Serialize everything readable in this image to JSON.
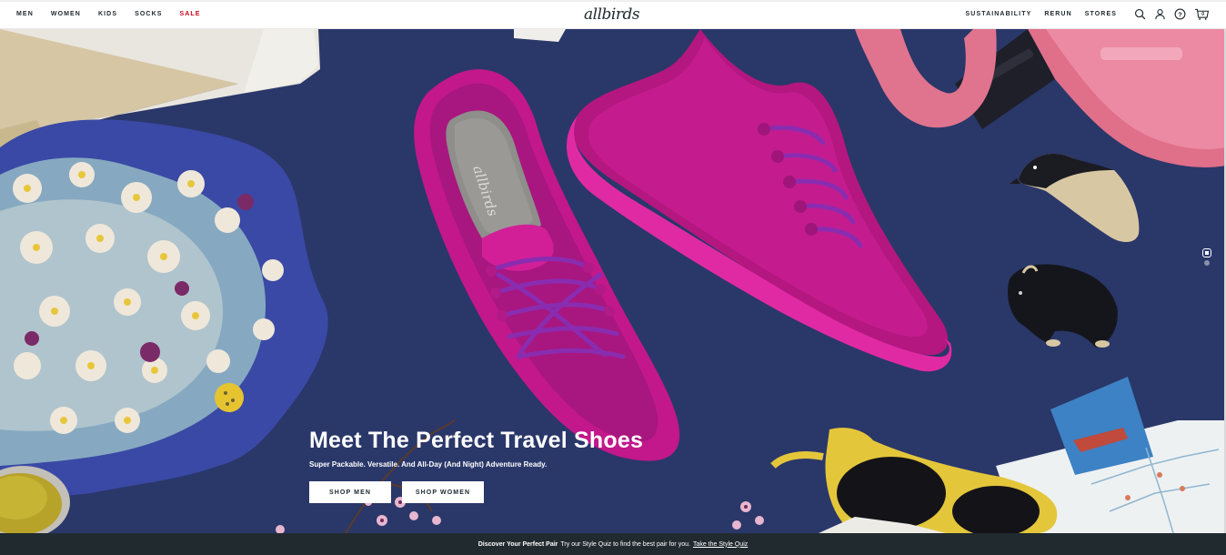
{
  "header": {
    "nav_left": [
      {
        "label": "MEN"
      },
      {
        "label": "WOMEN"
      },
      {
        "label": "KIDS"
      },
      {
        "label": "SOCKS"
      },
      {
        "label": "SALE"
      }
    ],
    "logo": "allbirds",
    "nav_right": [
      {
        "label": "SUSTAINABILITY"
      },
      {
        "label": "RERUN"
      },
      {
        "label": "STORES"
      }
    ],
    "icons": [
      "search-icon",
      "account-icon",
      "help-icon",
      "cart-icon"
    ],
    "cart_count": "0"
  },
  "hero": {
    "title": "Meet The Perfect Travel Shoes",
    "subtitle": "Super Packable. Versatile. And All-Day (And Night) Adventure Ready.",
    "cta_men": "SHOP MEN",
    "cta_women": "SHOP WOMEN",
    "insole_brand": "allbirds",
    "slides": 2,
    "active_slide": 1
  },
  "promo_bar": {
    "bold": "Discover Your Perfect Pair",
    "text": "Try our Style Quiz to find the best pair for you.",
    "link": "Take the Style Quiz"
  },
  "colors": {
    "background_navy": "#2c3a6e",
    "shoe_magenta": "#c2188b",
    "sale_red": "#d0021b",
    "footer_dark": "#212a2f"
  }
}
